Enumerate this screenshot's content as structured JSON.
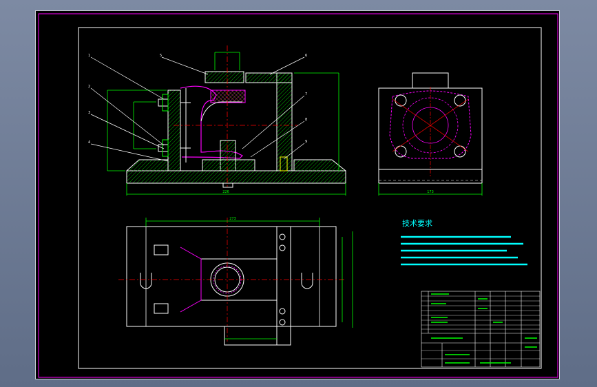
{
  "colors": {
    "background": "#000000",
    "outline": "#ffffff",
    "magenta": "#ff00ff",
    "green": "#00ff00",
    "red": "#ff0000",
    "yellow": "#ffff00",
    "cyan": "#00ffff",
    "hatch": "#00b000"
  },
  "notes": {
    "title": "技术要求"
  },
  "dims": {
    "base_width": "226",
    "plan_width": "273",
    "side_width": "173"
  },
  "callouts": [
    "1",
    "2",
    "3",
    "4",
    "5",
    "6",
    "7",
    "8",
    "9"
  ]
}
